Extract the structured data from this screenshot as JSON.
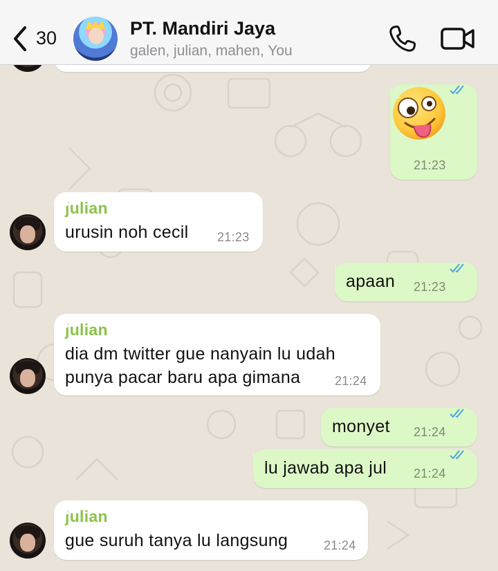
{
  "header": {
    "back_count": "30",
    "title": "PT. Mandiri Jaya",
    "members": "galen, julian, mahen, You"
  },
  "messages": [
    {
      "type": "sticker",
      "emoji": "zany-face",
      "time": "21:23"
    },
    {
      "type": "in",
      "sender": "julian",
      "text": "urusin noh cecil",
      "time": "21:23"
    },
    {
      "type": "out",
      "text": "apaan",
      "time": "21:23"
    },
    {
      "type": "in",
      "sender": "julian",
      "text": "dia dm twitter gue nanyain lu udah",
      "text2": "punya pacar baru apa gimana",
      "time": "21:24"
    },
    {
      "type": "out",
      "text": "monyet",
      "time": "21:24"
    },
    {
      "type": "out",
      "text": "lu jawab apa jul",
      "time": "21:24"
    },
    {
      "type": "in",
      "sender": "julian",
      "text": "gue suruh tanya lu langsung",
      "time": "21:24"
    }
  ],
  "colors": {
    "sender_name": "#8bc34a",
    "outgoing_bubble": "#dcf8c6",
    "incoming_bubble": "#ffffff",
    "read_ticks": "#4fa3e0"
  }
}
